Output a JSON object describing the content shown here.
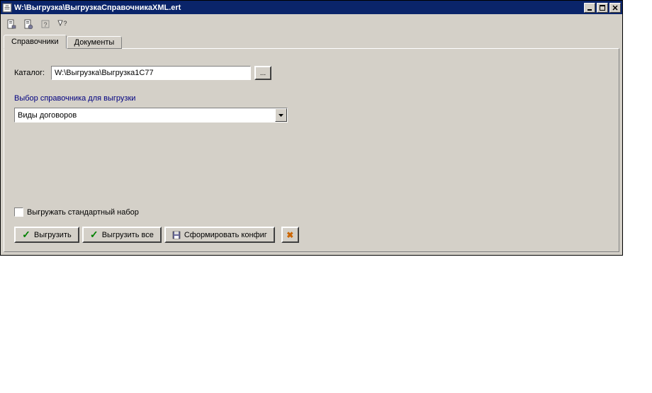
{
  "window": {
    "title": "W:\\Выгрузка\\ВыгрузкаСправочникаXML.ert"
  },
  "tabs": {
    "active": "Справочники",
    "inactive": "Документы"
  },
  "catalog": {
    "label": "Каталог:",
    "value": "W:\\Выгрузка\\Выгрузка1С77",
    "browse": "..."
  },
  "section": {
    "title": "Выбор справочника для выгрузки",
    "selected": "Виды договоров"
  },
  "checkbox": {
    "label": "Выгружать стандартный набор",
    "checked": false
  },
  "buttons": {
    "export": "Выгрузить",
    "export_all": "Выгрузить все",
    "form_config": "Сформировать конфиг"
  },
  "toolbar_icons": [
    "form-icon",
    "form-alt-icon",
    "help-icon",
    "context-help-icon"
  ]
}
